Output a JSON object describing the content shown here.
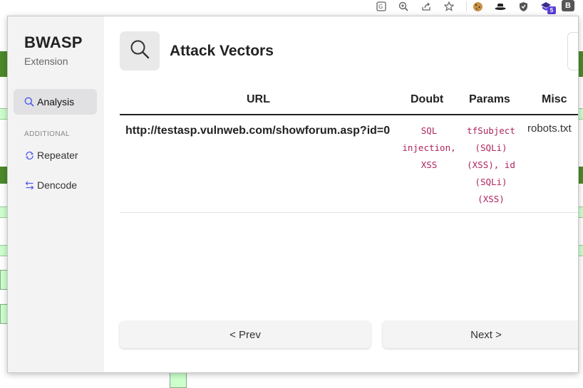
{
  "browser": {
    "profile_initial": "B",
    "extension_badge": "5",
    "icons": [
      "translate-icon",
      "zoom-icon",
      "share-icon",
      "star-icon",
      "cookie-icon",
      "hat-icon",
      "shield-icon",
      "extension-icon"
    ]
  },
  "sidebar": {
    "brand": "BWASP",
    "subtitle": "Extension",
    "items": [
      {
        "label": "Analysis",
        "icon": "search-icon",
        "active": true
      }
    ],
    "section_label": "ADDITIONAL",
    "additional": [
      {
        "label": "Repeater",
        "icon": "refresh-icon"
      },
      {
        "label": "Dencode",
        "icon": "swap-icon"
      }
    ]
  },
  "main": {
    "title": "Attack Vectors",
    "table": {
      "headers": [
        "URL",
        "Doubt",
        "Params",
        "Misc"
      ],
      "rows": [
        {
          "url": "http://testasp.vulnweb.com/showforum.asp?id=0",
          "doubt": [
            "SQL",
            "injection,",
            "XSS"
          ],
          "params": [
            "tfSubject",
            "(SQLi)",
            "(XSS), id",
            "(SQLi)",
            "(XSS)"
          ],
          "misc": "robots.txt"
        }
      ]
    },
    "pagination": {
      "prev": "< Prev",
      "next": "Next >"
    }
  },
  "colors": {
    "sidebar_bg": "#f3f3f4",
    "active_item_bg": "#e1e1e4",
    "code_text": "#b0245f",
    "bg_page_green": "#4a8a2a",
    "bg_page_light_green": "#ccffcc"
  }
}
